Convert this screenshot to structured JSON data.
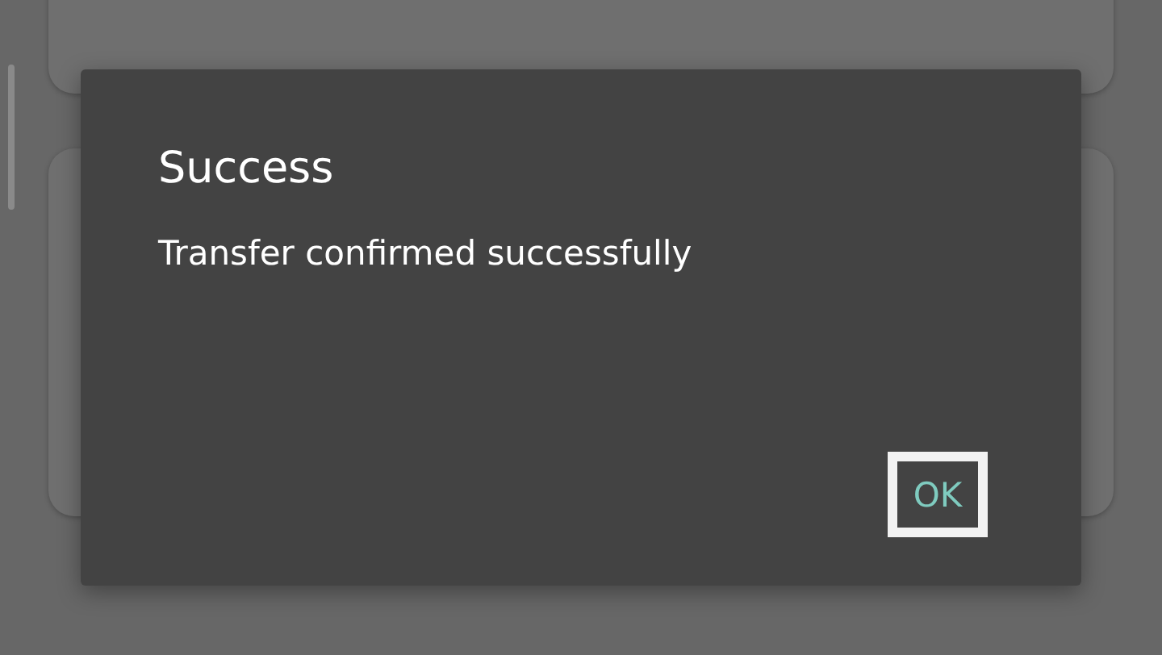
{
  "dialog": {
    "title": "Success",
    "message": "Transfer confirmed successfully",
    "buttons": [
      {
        "label": "OK",
        "focused": true
      }
    ]
  }
}
